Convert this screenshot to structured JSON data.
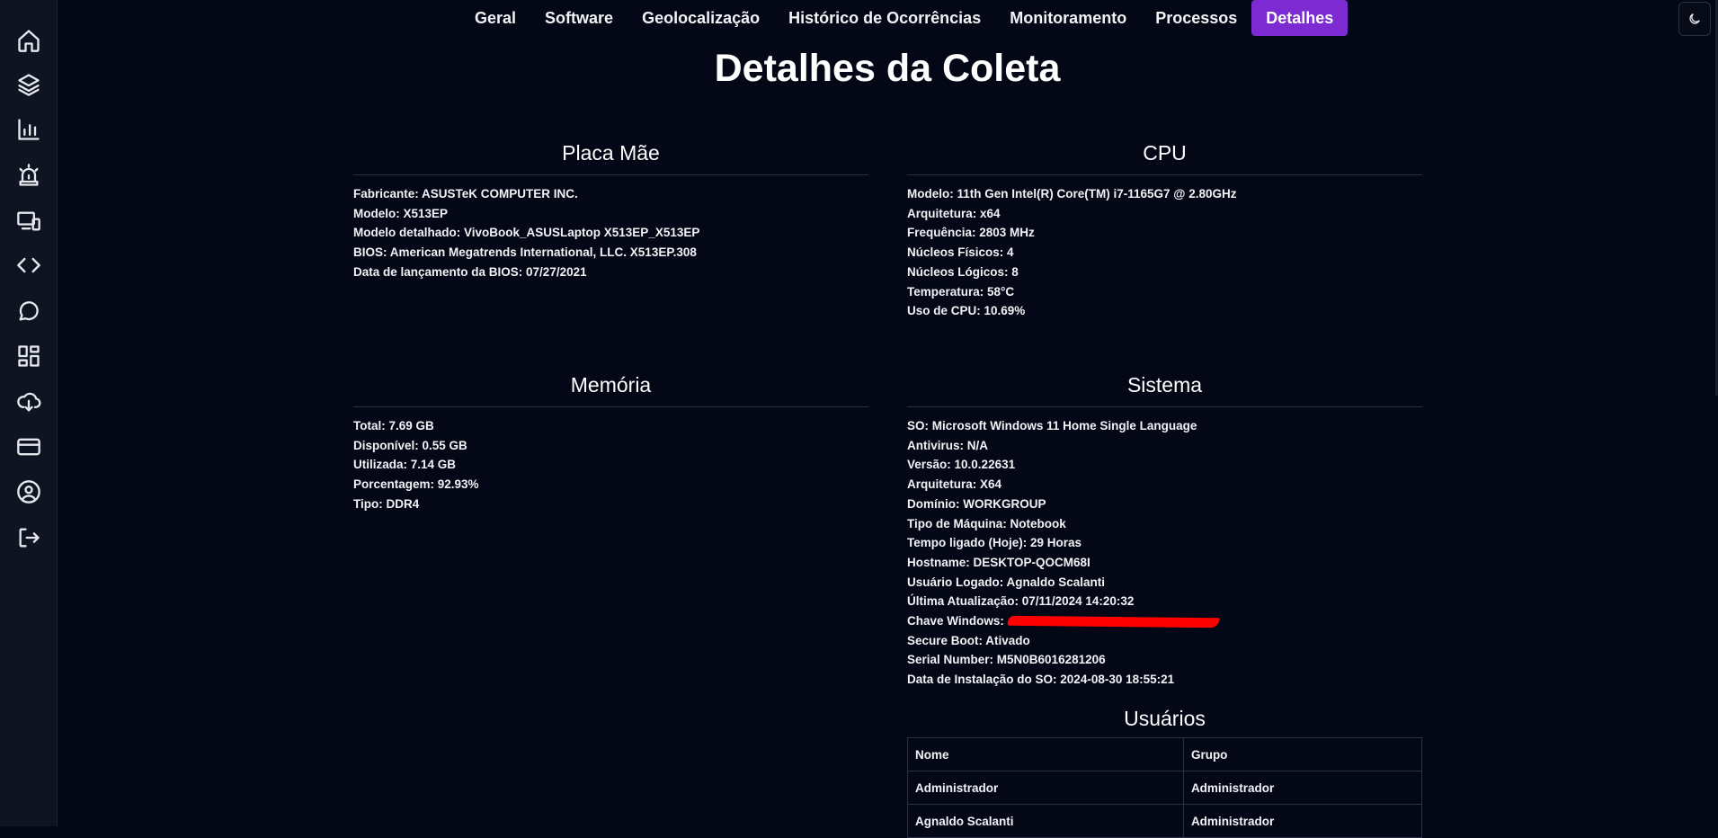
{
  "nav": {
    "tabs": [
      {
        "label": "Geral"
      },
      {
        "label": "Software"
      },
      {
        "label": "Geolocalização"
      },
      {
        "label": "Histórico de Ocorrências"
      },
      {
        "label": "Monitoramento"
      },
      {
        "label": "Processos"
      },
      {
        "label": "Detalhes"
      }
    ],
    "active_tab": "Detalhes"
  },
  "sidebar": {
    "icons": [
      "home-icon",
      "layers-icon",
      "bar-chart-icon",
      "siren-icon",
      "monitor-devices-icon",
      "code-icon",
      "chat-icon",
      "dashboard-icon",
      "cloud-download-icon",
      "credit-card-icon",
      "user-circle-icon",
      "logout-icon"
    ]
  },
  "page": {
    "title": "Detalhes da Coleta"
  },
  "placa_mae": {
    "title": "Placa Mãe",
    "items": [
      "Fabricante: ASUSTeK COMPUTER INC.",
      "Modelo: X513EP",
      "Modelo detalhado: VivoBook_ASUSLaptop X513EP_X513EP",
      "BIOS: American Megatrends International, LLC. X513EP.308",
      "Data de lançamento da BIOS: 07/27/2021"
    ]
  },
  "cpu": {
    "title": "CPU",
    "items": [
      "Modelo: 11th Gen Intel(R) Core(TM) i7-1165G7 @ 2.80GHz",
      "Arquitetura: x64",
      "Frequência: 2803 MHz",
      "Núcleos Físicos: 4",
      "Núcleos Lógicos: 8",
      "Temperatura: 58°C",
      "Uso de CPU: 10.69%"
    ]
  },
  "memoria": {
    "title": "Memória",
    "items": [
      "Total: 7.69 GB",
      "Disponível: 0.55 GB",
      "Utilizada: 7.14 GB",
      "Porcentagem: 92.93%",
      "Tipo: DDR4"
    ]
  },
  "sistema": {
    "title": "Sistema",
    "items_before": [
      "SO: Microsoft Windows 11 Home Single Language",
      "Antivirus: N/A",
      "Versão: 10.0.22631",
      "Arquitetura: X64",
      "Domínio: WORKGROUP",
      "Tipo de Máquina: Notebook",
      "Tempo ligado (Hoje): 29 Horas",
      "Hostname: DESKTOP-QOCM68I",
      "Usuário Logado: Agnaldo Scalanti",
      "Última Atualização: 07/11/2024 14:20:32"
    ],
    "chave_label": "Chave Windows:",
    "items_after": [
      "Secure Boot: Ativado",
      "Serial Number: M5N0B6016281206",
      "Data de Instalação do SO: 2024-08-30 18:55:21"
    ]
  },
  "usuarios": {
    "title": "Usuários",
    "headers": [
      "Nome",
      "Grupo"
    ],
    "rows": [
      [
        "Administrador",
        "Administrador"
      ],
      [
        "Agnaldo Scalanti",
        "Administrador"
      ]
    ]
  },
  "colors": {
    "accent": "#7b2bd1",
    "background": "#030716",
    "sidebar": "#0e1421"
  }
}
